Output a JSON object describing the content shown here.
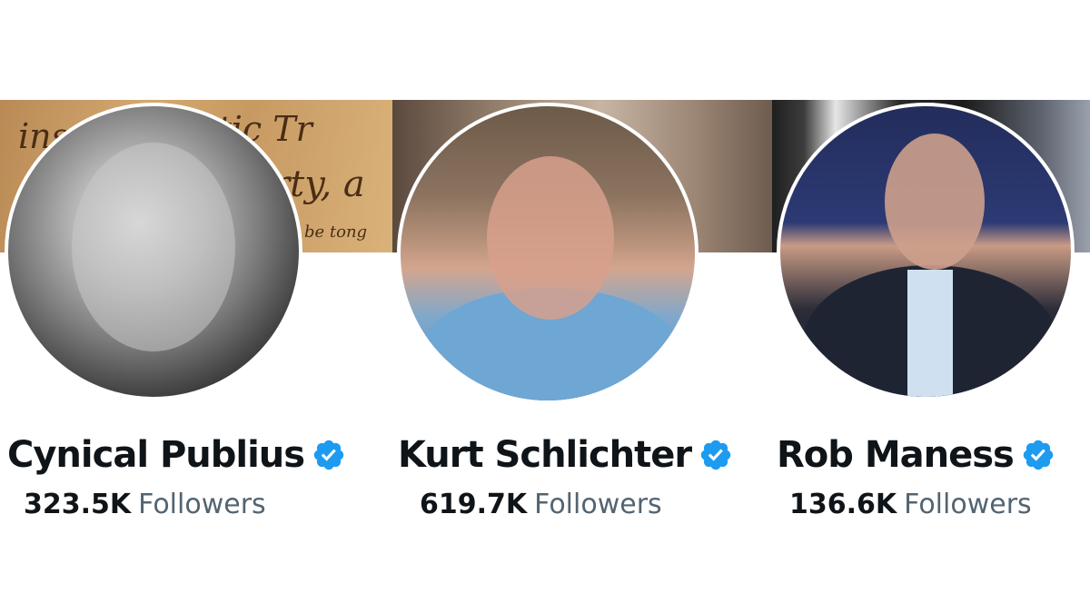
{
  "profiles": [
    {
      "name": "Cynical Publius",
      "followers_count": "323.5K",
      "followers_label": "Followers",
      "verified": true
    },
    {
      "name": "Kurt Schlichter",
      "followers_count": "619.7K",
      "followers_label": "Followers",
      "verified": true
    },
    {
      "name": "Rob Maness",
      "followers_count": "136.6K",
      "followers_label": "Followers",
      "verified": true
    }
  ],
  "colors": {
    "text_primary": "#0f1419",
    "text_secondary": "#536471",
    "verified_badge": "#1d9bf0"
  },
  "icons": {
    "verified": "verified-badge-icon"
  }
}
